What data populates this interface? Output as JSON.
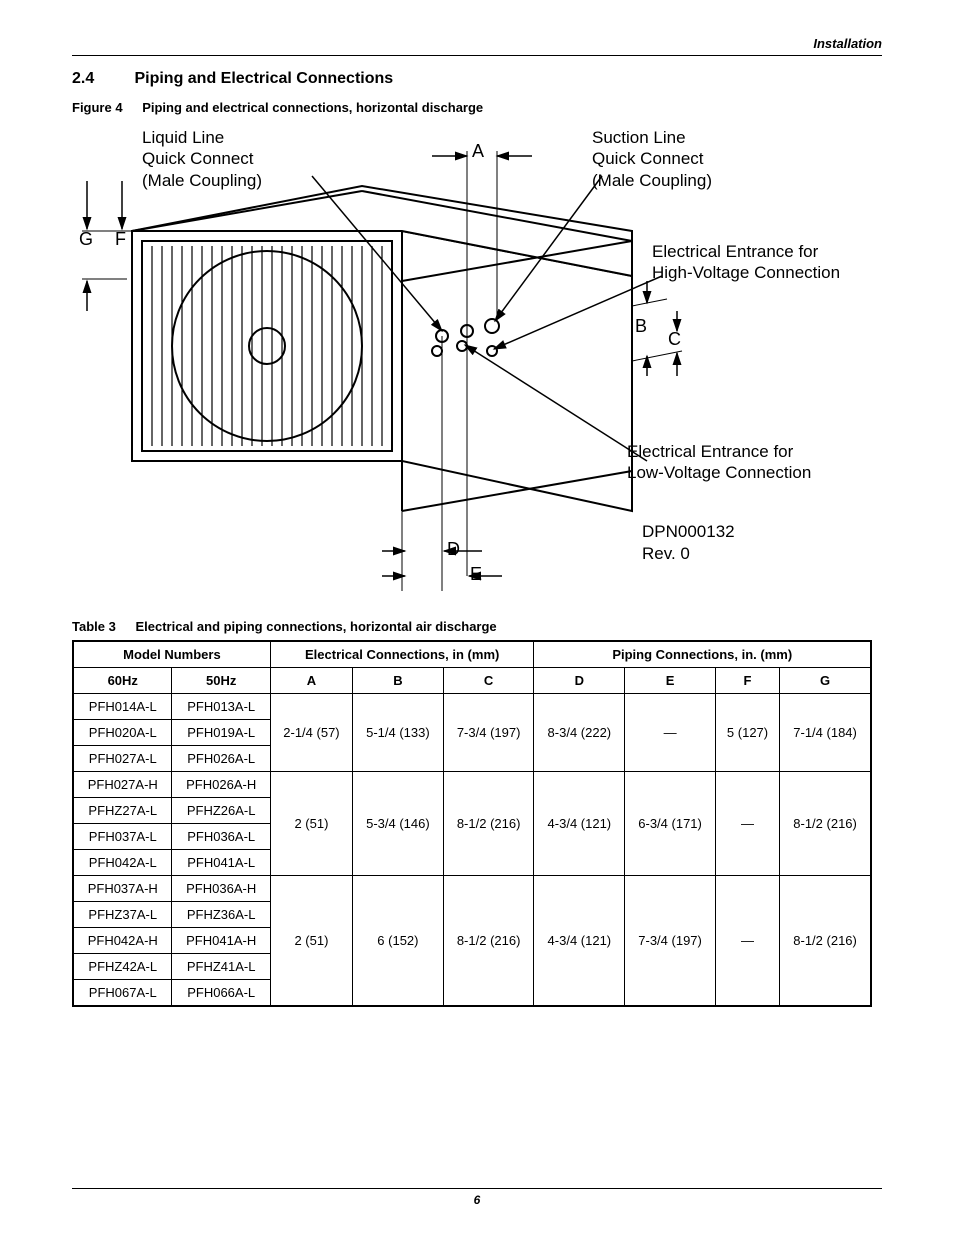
{
  "header": {
    "section": "Installation"
  },
  "section": {
    "number": "2.4",
    "title": "Piping and Electrical Connections"
  },
  "figure": {
    "label": "Figure 4",
    "title": "Piping and electrical connections, horizontal discharge",
    "labels": {
      "liquid_line": "Liquid Line\nQuick Connect\n(Male Coupling)",
      "suction_line": "Suction Line\nQuick Connect\n(Male Coupling)",
      "elec_high": "Electrical Entrance for\nHigh-Voltage Connection",
      "elec_low": "Electrical Entrance for\nLow-Voltage Connection",
      "drawing_no": "DPN000132",
      "rev": "Rev. 0",
      "A": "A",
      "B": "B",
      "C": "C",
      "D": "D",
      "E": "E",
      "F": "F",
      "G": "G"
    }
  },
  "table": {
    "label": "Table 3",
    "title": "Electrical and piping connections, horizontal air discharge",
    "headers": {
      "model_numbers": "Model Numbers",
      "elec_conn": "Electrical Connections, in (mm)",
      "pipe_conn": "Piping Connections, in. (mm)",
      "hz60": "60Hz",
      "hz50": "50Hz",
      "A": "A",
      "B": "B",
      "C": "C",
      "D": "D",
      "E": "E",
      "F": "F",
      "G": "G"
    },
    "groups": [
      {
        "rows": [
          {
            "hz60": "PFH014A-L",
            "hz50": "PFH013A-L"
          },
          {
            "hz60": "PFH020A-L",
            "hz50": "PFH019A-L"
          },
          {
            "hz60": "PFH027A-L",
            "hz50": "PFH026A-L"
          }
        ],
        "A": "2-1/4 (57)",
        "B": "5-1/4 (133)",
        "C": "7-3/4 (197)",
        "D": "8-3/4 (222)",
        "E": "—",
        "F": "5 (127)",
        "G": "7-1/4 (184)"
      },
      {
        "rows": [
          {
            "hz60": "PFH027A-H",
            "hz50": "PFH026A-H"
          },
          {
            "hz60": "PFHZ27A-L",
            "hz50": "PFHZ26A-L"
          },
          {
            "hz60": "PFH037A-L",
            "hz50": "PFH036A-L"
          },
          {
            "hz60": "PFH042A-L",
            "hz50": "PFH041A-L"
          }
        ],
        "A": "2 (51)",
        "B": "5-3/4 (146)",
        "C": "8-1/2 (216)",
        "D": "4-3/4 (121)",
        "E": "6-3/4 (171)",
        "F": "—",
        "G": "8-1/2 (216)"
      },
      {
        "rows": [
          {
            "hz60": "PFH037A-H",
            "hz50": "PFH036A-H"
          },
          {
            "hz60": "PFHZ37A-L",
            "hz50": "PFHZ36A-L"
          },
          {
            "hz60": "PFH042A-H",
            "hz50": "PFH041A-H"
          },
          {
            "hz60": "PFHZ42A-L",
            "hz50": "PFHZ41A-L"
          },
          {
            "hz60": "PFH067A-L",
            "hz50": "PFH066A-L"
          }
        ],
        "A": "2 (51)",
        "B": "6 (152)",
        "C": "8-1/2 (216)",
        "D": "4-3/4 (121)",
        "E": "7-3/4 (197)",
        "F": "—",
        "G": "8-1/2 (216)"
      }
    ]
  },
  "footer": {
    "page": "6"
  }
}
